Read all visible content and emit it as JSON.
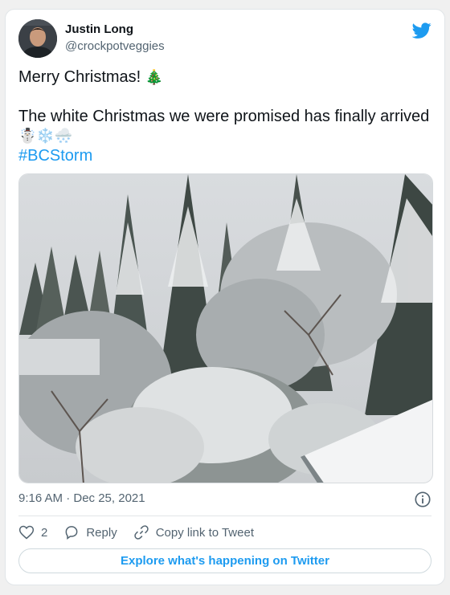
{
  "author": {
    "name": "Justin Long",
    "handle": "@crockpotveggies",
    "avatar": "avatar-photo"
  },
  "tweet": {
    "line1": "Merry Christmas! ",
    "line1_emoji": "🎄",
    "line2": "The white Christmas we were promised has finally arrived",
    "line2_emoji": "☃️❄️🌨️",
    "hashtag": "#BCStorm"
  },
  "media": {
    "description_icon": "snowy-forest-photo"
  },
  "timestamp": "9:16 AM · Dec 25, 2021",
  "actions": {
    "like_count": "2",
    "reply_label": "Reply",
    "copy_label": "Copy link to Tweet"
  },
  "explore_label": "Explore what's happening on Twitter",
  "colors": {
    "accent": "#1d9bf0",
    "text_secondary": "#536471",
    "like_icon": "#536471"
  }
}
